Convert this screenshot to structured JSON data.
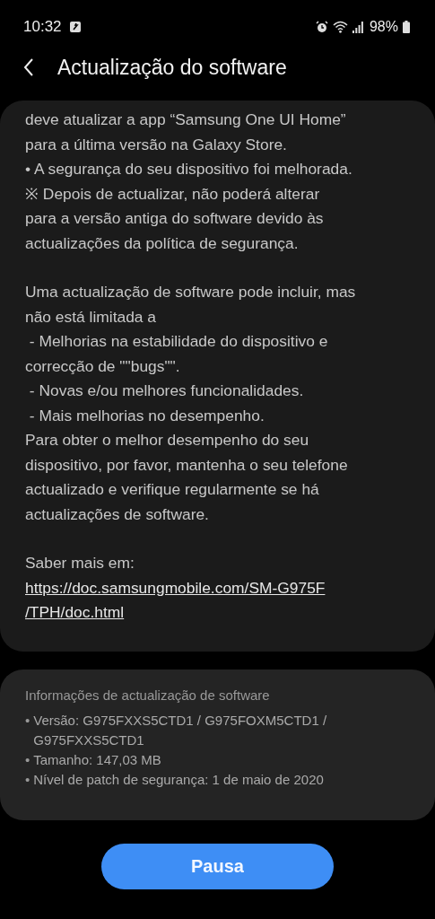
{
  "status_bar": {
    "time": "10:32",
    "battery": "98%"
  },
  "header": {
    "title": "Actualização do software"
  },
  "notes": [
    {
      "lines": [
        "deve atualizar a app “Samsung One UI Home”",
        "para a última versão na Galaxy Store.",
        "• A segurança do seu dispositivo foi melhorada.",
        "※ Depois de actualizar, não poderá alterar",
        "para a versão antiga do software devido às",
        "actualizações da política de segurança."
      ]
    },
    {
      "lines": [
        "Uma actualização de software pode incluir, mas",
        "não está limitada a",
        " - Melhorias na estabilidade do dispositivo e",
        "correcção de \"\"bugs\"\".",
        " - Novas e/ou melhores funcionalidades.",
        " - Mais melhorias no desempenho.",
        "Para obter o melhor desempenho do seu",
        "dispositivo, por favor, mantenha o seu telefone",
        "actualizado e verifique regularmente se há",
        "actualizações de software."
      ]
    },
    {
      "lines": [
        "Saber mais em:"
      ],
      "link": [
        "https://doc.samsungmobile.com/SM-G975F",
        "/TPH/doc.html"
      ]
    }
  ],
  "info": {
    "title": "Informações de actualização de software",
    "items": [
      {
        "lines": [
          "Versão: G975FXXS5CTD1 / G975FOXM5CTD1 /",
          "G975FXXS5CTD1"
        ]
      },
      {
        "lines": [
          "Tamanho: 147,03 MB"
        ]
      },
      {
        "lines": [
          "Nível de patch de segurança: 1 de maio de 2020"
        ]
      }
    ],
    "bullet": "•"
  },
  "button": {
    "label": "Pausa"
  }
}
